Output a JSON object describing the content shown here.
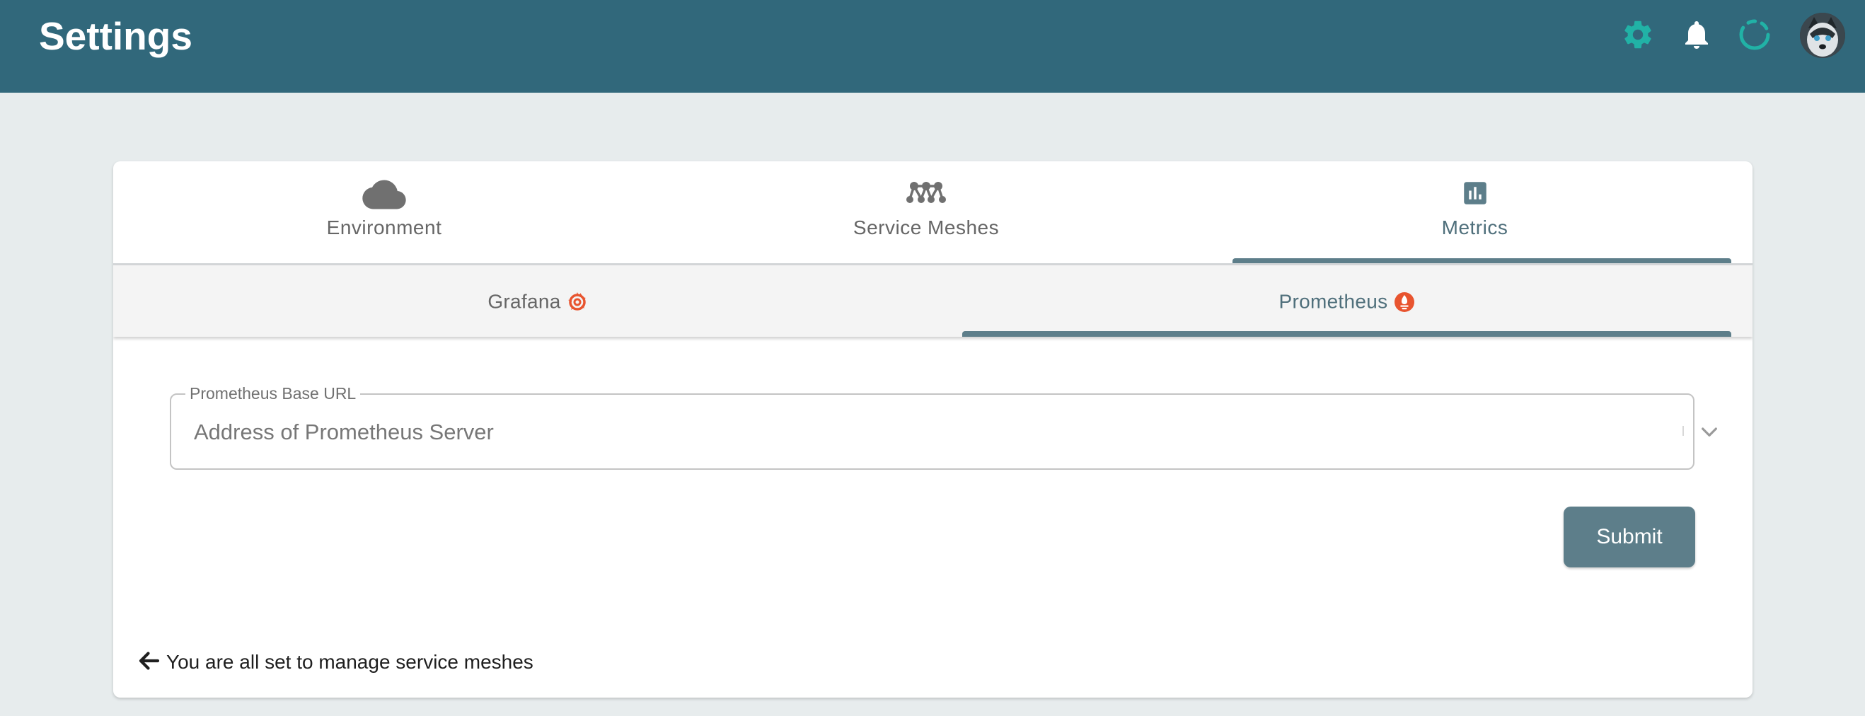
{
  "appbar": {
    "title": "Settings",
    "icons": [
      "gear-icon",
      "bell-icon",
      "loading-spinner-icon",
      "avatar"
    ],
    "color": "#31687b",
    "accent": "#21b2a6"
  },
  "tabs": [
    {
      "label": "Environment",
      "icon": "cloud-icon"
    },
    {
      "label": "Service Meshes",
      "icon": "mesh-icon"
    },
    {
      "label": "Metrics",
      "icon": "bar-chart-icon",
      "active": true
    }
  ],
  "subtabs": [
    {
      "label": "Grafana",
      "icon": "grafana-icon"
    },
    {
      "label": "Prometheus",
      "icon": "prometheus-icon",
      "active": true
    }
  ],
  "form": {
    "label": "Prometheus Base URL",
    "placeholder": "Address of Prometheus Server",
    "value": "",
    "submit_label": "Submit"
  },
  "footer": {
    "back_text": "You are all set to manage service meshes"
  },
  "colors": {
    "tab_indicator": "#5d7e8a",
    "submit_bg": "#5d7e8a",
    "brand_orange": "#e8542f"
  }
}
